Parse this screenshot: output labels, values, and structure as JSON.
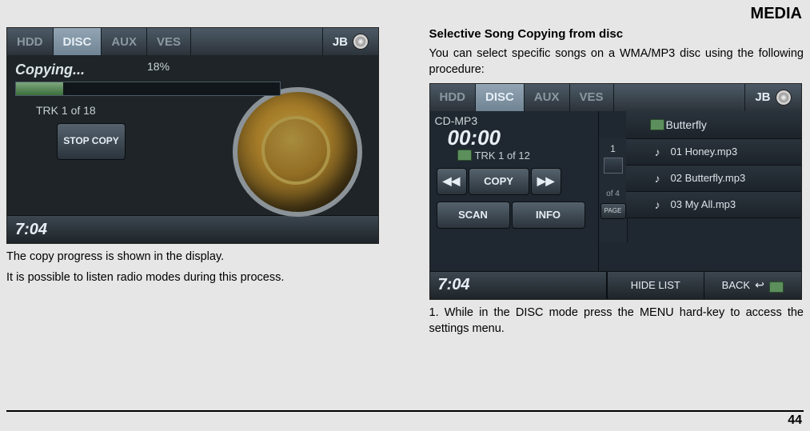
{
  "header": {
    "title": "MEDIA"
  },
  "page_number": "44",
  "left": {
    "tabs": [
      "HDD",
      "DISC",
      "AUX",
      "VES"
    ],
    "jb_label": "JB",
    "copying_label": "Copying...",
    "progress_pct": "18%",
    "track_info": "TRK 1 of 18",
    "stop_copy_label": "STOP COPY",
    "clock": "7:04",
    "caption_1": "The copy progress is shown in the display.",
    "caption_2": "It is possible to listen radio modes during this process."
  },
  "right": {
    "subhead": "Selective Song Copying from disc",
    "intro": "You can select specific songs on a WMA/MP3 disc using the following procedure:",
    "tabs": [
      "HDD",
      "DISC",
      "AUX",
      "VES"
    ],
    "jb_label": "JB",
    "cdmp3_label": "CD-MP3",
    "elapsed": "00:00",
    "track_info": "TRK 1 of 12",
    "copy_label": "COPY",
    "scan_label": "SCAN",
    "info_label": "INFO",
    "prev_label": "◀◀",
    "next_label": "▶▶",
    "pager_current": "1",
    "pager_of_label": "of 4",
    "pager_page_label": "PAGE",
    "folder_name": "Butterfly",
    "songs": [
      "01 Honey.mp3",
      "02 Butterfly.mp3",
      "03 My All.mp3"
    ],
    "clock": "7:04",
    "hide_list_label": "HIDE LIST",
    "back_label": "BACK",
    "caption_1": "1. While in the DISC mode press the MENU hard-key to access the settings menu."
  }
}
